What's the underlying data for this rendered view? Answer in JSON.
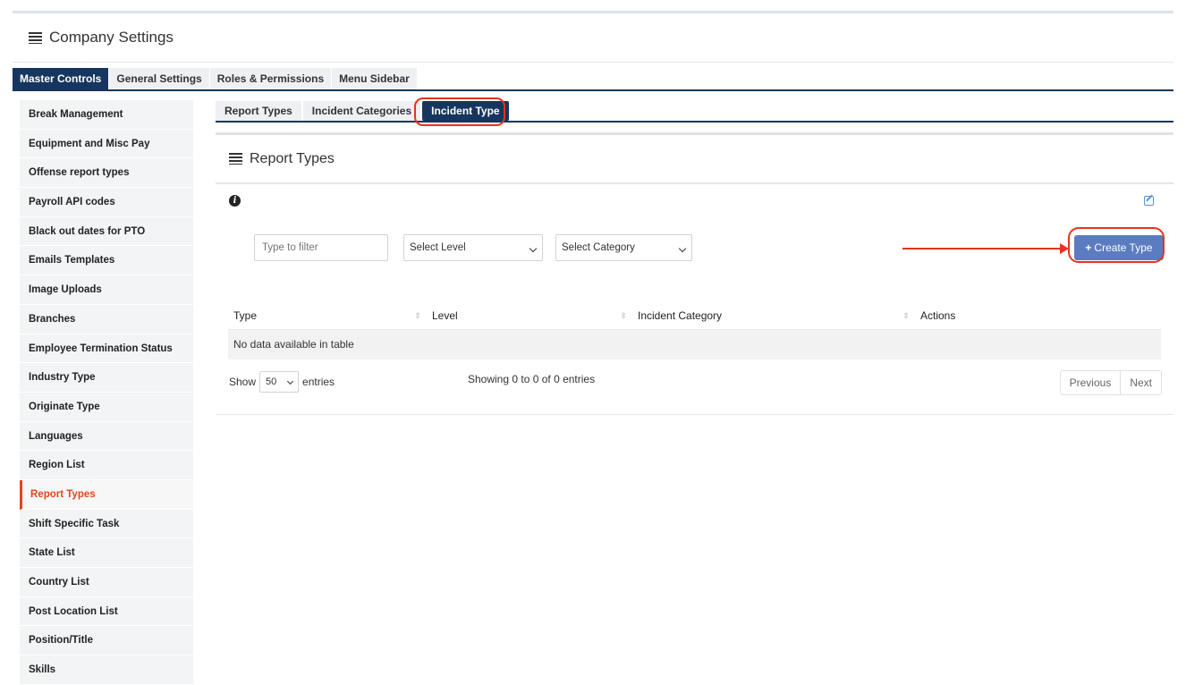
{
  "page": {
    "title": "Company Settings"
  },
  "top_tabs": [
    {
      "label": "Master Controls",
      "active": true
    },
    {
      "label": "General Settings",
      "active": false
    },
    {
      "label": "Roles & Permissions",
      "active": false
    },
    {
      "label": "Menu Sidebar",
      "active": false
    }
  ],
  "sidebar": {
    "items": [
      {
        "label": "Break Management"
      },
      {
        "label": "Equipment and Misc Pay"
      },
      {
        "label": "Offense report types"
      },
      {
        "label": "Payroll API codes"
      },
      {
        "label": "Black out dates for PTO"
      },
      {
        "label": "Emails Templates"
      },
      {
        "label": "Image Uploads"
      },
      {
        "label": "Branches"
      },
      {
        "label": "Employee Termination Status"
      },
      {
        "label": "Industry Type"
      },
      {
        "label": "Originate Type"
      },
      {
        "label": "Languages"
      },
      {
        "label": "Region List"
      },
      {
        "label": "Report Types",
        "active": true
      },
      {
        "label": "Shift Specific Task"
      },
      {
        "label": "State List"
      },
      {
        "label": "Country List"
      },
      {
        "label": "Post Location List"
      },
      {
        "label": "Position/Title"
      },
      {
        "label": "Skills"
      }
    ]
  },
  "sub_tabs": [
    {
      "label": "Report Types"
    },
    {
      "label": "Incident Categories"
    },
    {
      "label": "Incident Type",
      "active": true
    }
  ],
  "panel": {
    "title": "Report Types",
    "filter_placeholder": "Type to filter",
    "select_level": "Select Level",
    "select_category": "Select Category",
    "create_button": "Create Type"
  },
  "table": {
    "columns": [
      "Type",
      "Level",
      "Incident Category",
      "Actions"
    ],
    "empty_message": "No data available in table"
  },
  "footer": {
    "show_label": "Show",
    "page_length": "50",
    "entries_label": "entries",
    "info": "Showing 0 to 0 of 0 entries",
    "previous": "Previous",
    "next": "Next"
  },
  "colors": {
    "primary": "#17365f",
    "accent": "#e8431b",
    "button": "#5b7cc0"
  }
}
